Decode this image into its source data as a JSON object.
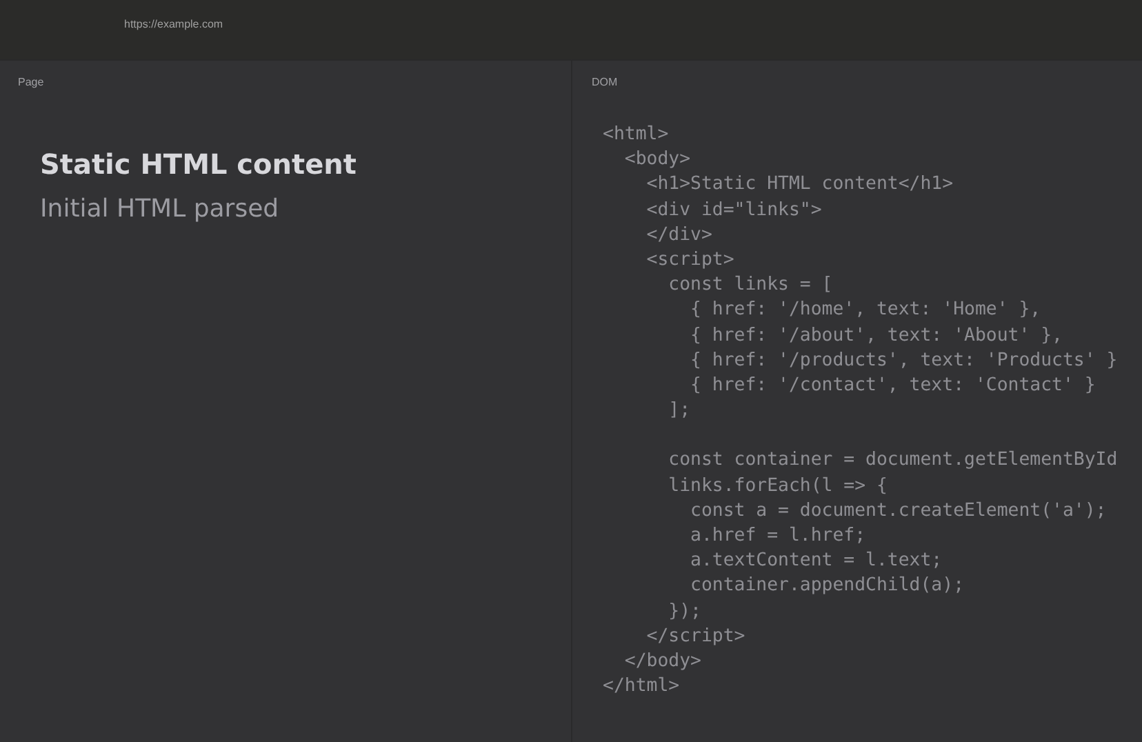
{
  "address_bar": {
    "url": "https://example.com"
  },
  "page_panel": {
    "label": "Page",
    "heading": "Static HTML content",
    "subtitle": "Initial HTML parsed"
  },
  "dom_panel": {
    "label": "DOM",
    "code_blocks": [
      [
        "<html>",
        "  <body>",
        "    <h1>Static HTML content</h1>",
        "    <div id=\"links\">",
        "    </div>",
        "    <script>",
        "      const links = [",
        "        { href: '/home', text: 'Home' },",
        "        { href: '/about', text: 'About' },",
        "        { href: '/products', text: 'Products' }",
        "        { href: '/contact', text: 'Contact' }",
        "      ];"
      ],
      [
        "      const container = document.getElementById",
        "      links.forEach(l => {",
        "        const a = document.createElement('a');",
        "        a.href = l.href;",
        "        a.textContent = l.text;",
        "        container.appendChild(a);",
        "      });",
        "    </script>",
        "  </body>",
        "</html>"
      ]
    ]
  }
}
